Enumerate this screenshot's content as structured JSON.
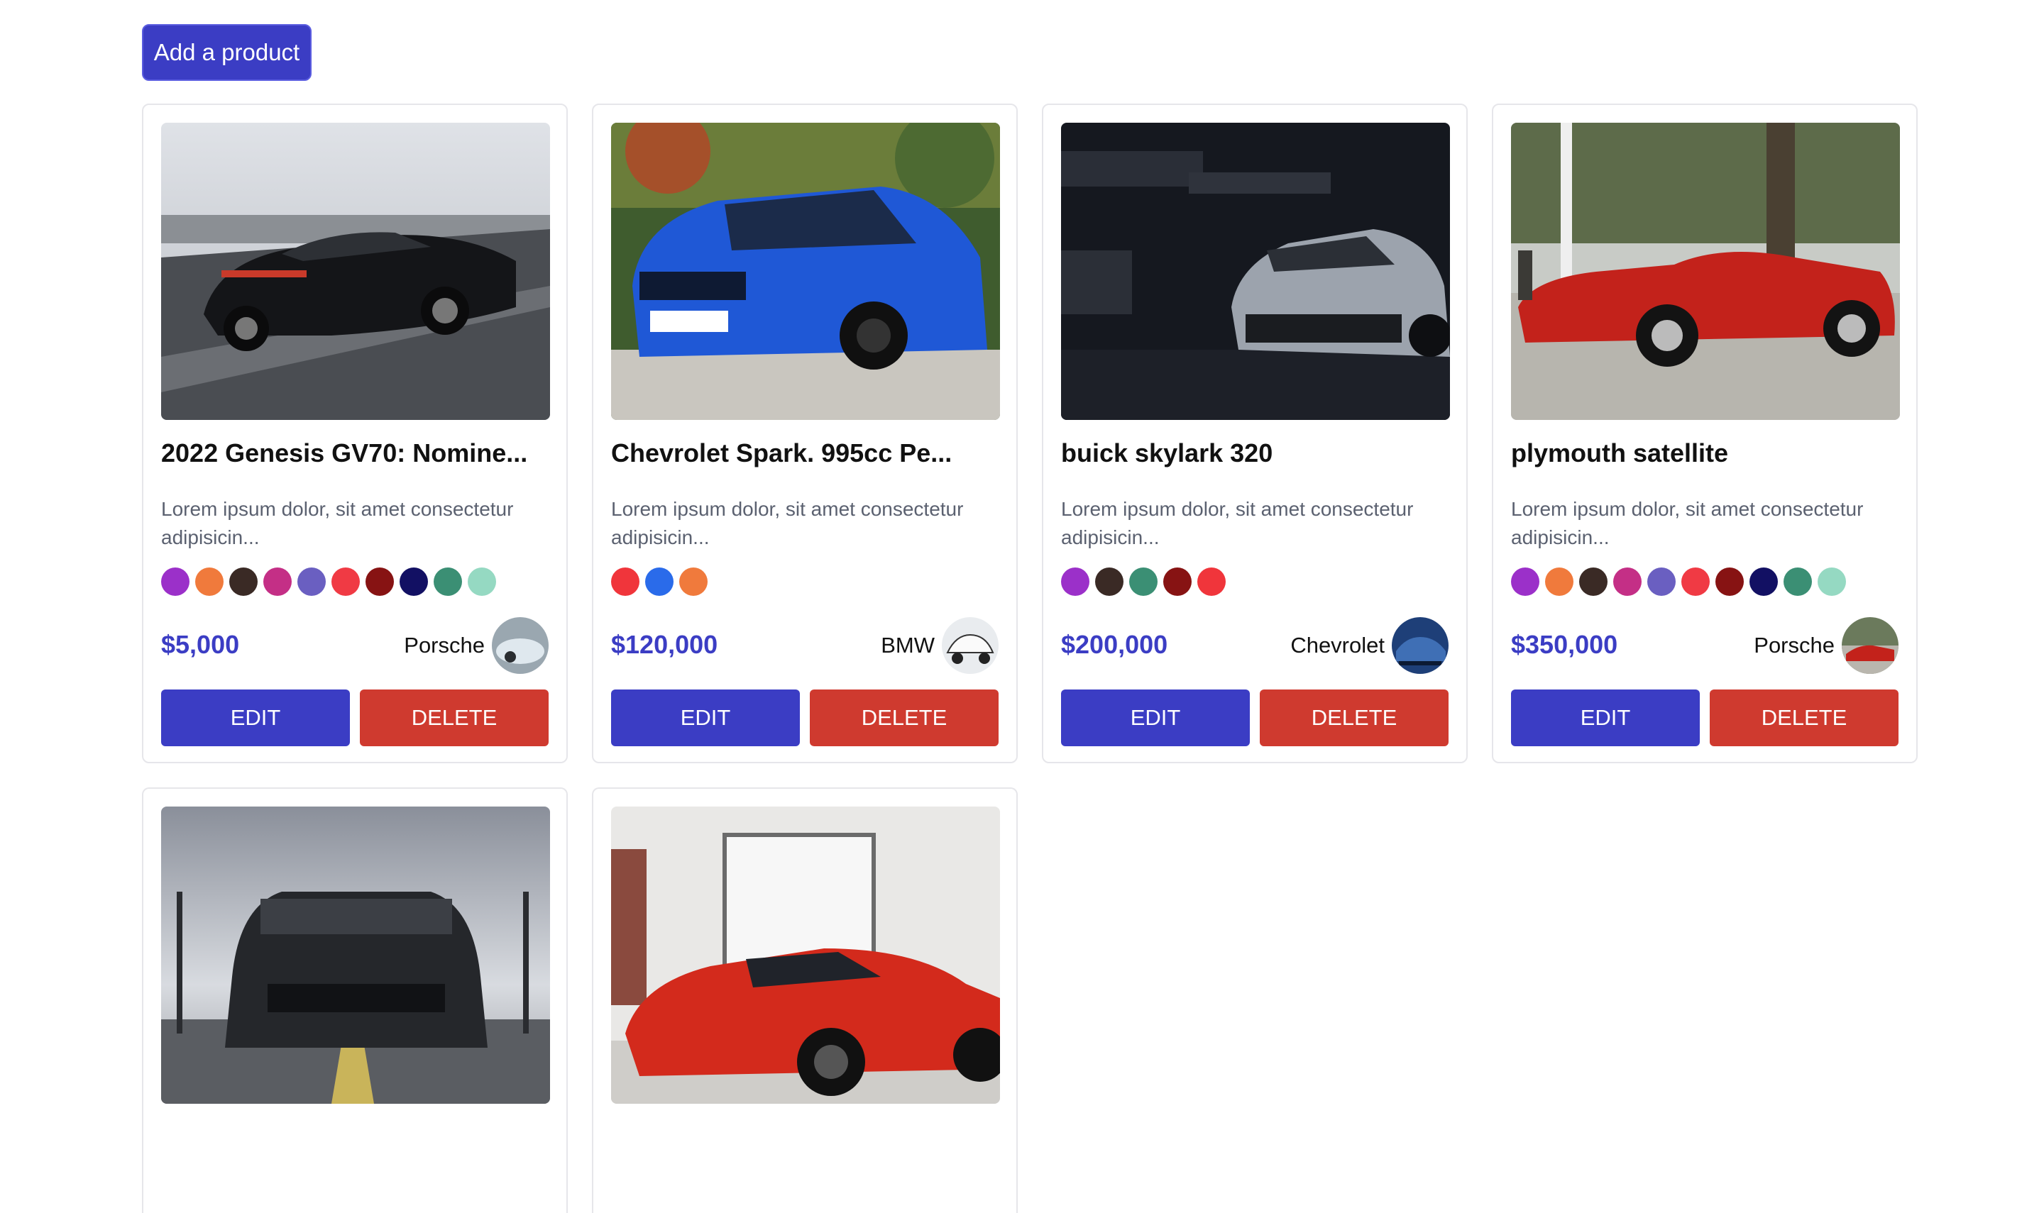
{
  "toolbar": {
    "add_label": "Add a product"
  },
  "products": [
    {
      "title": "2022 Genesis GV70: Nomine...",
      "description": "Lorem ipsum dolor, sit amet consectetur adipisicin...",
      "colors": [
        "#9b30c9",
        "#f07a3c",
        "#3a2a25",
        "#c42f86",
        "#6a5fc1",
        "#f03a44",
        "#871313",
        "#121063",
        "#3b8f74",
        "#95d9c2"
      ],
      "price": "$5,000",
      "brand": "Porsche",
      "edit_label": "EDIT",
      "delete_label": "DELETE"
    },
    {
      "title": "Chevrolet Spark. 995cc Pe...",
      "description": "Lorem ipsum dolor, sit amet consectetur adipisicin...",
      "colors": [
        "#f0353b",
        "#2a6bea",
        "#f07a3c"
      ],
      "price": "$120,000",
      "brand": "BMW",
      "edit_label": "EDIT",
      "delete_label": "DELETE"
    },
    {
      "title": "buick skylark 320",
      "description": "Lorem ipsum dolor, sit amet consectetur adipisicin...",
      "colors": [
        "#9b30c9",
        "#3a2a25",
        "#3b8f74",
        "#871313",
        "#f0353b"
      ],
      "price": "$200,000",
      "brand": "Chevrolet",
      "edit_label": "EDIT",
      "delete_label": "DELETE"
    },
    {
      "title": "plymouth satellite",
      "description": "Lorem ipsum dolor, sit amet consectetur adipisicin...",
      "colors": [
        "#9b30c9",
        "#f07a3c",
        "#3a2a25",
        "#c42f86",
        "#6a5fc1",
        "#f03a44",
        "#871313",
        "#121063",
        "#3b8f74",
        "#95d9c2"
      ],
      "price": "$350,000",
      "brand": "Porsche",
      "edit_label": "EDIT",
      "delete_label": "DELETE"
    }
  ],
  "partial_products_count": 2,
  "colors": {
    "accent": "#3b3dc4",
    "danger": "#cf3a2f",
    "description": "#5b6170",
    "border": "#e6e6ea"
  }
}
